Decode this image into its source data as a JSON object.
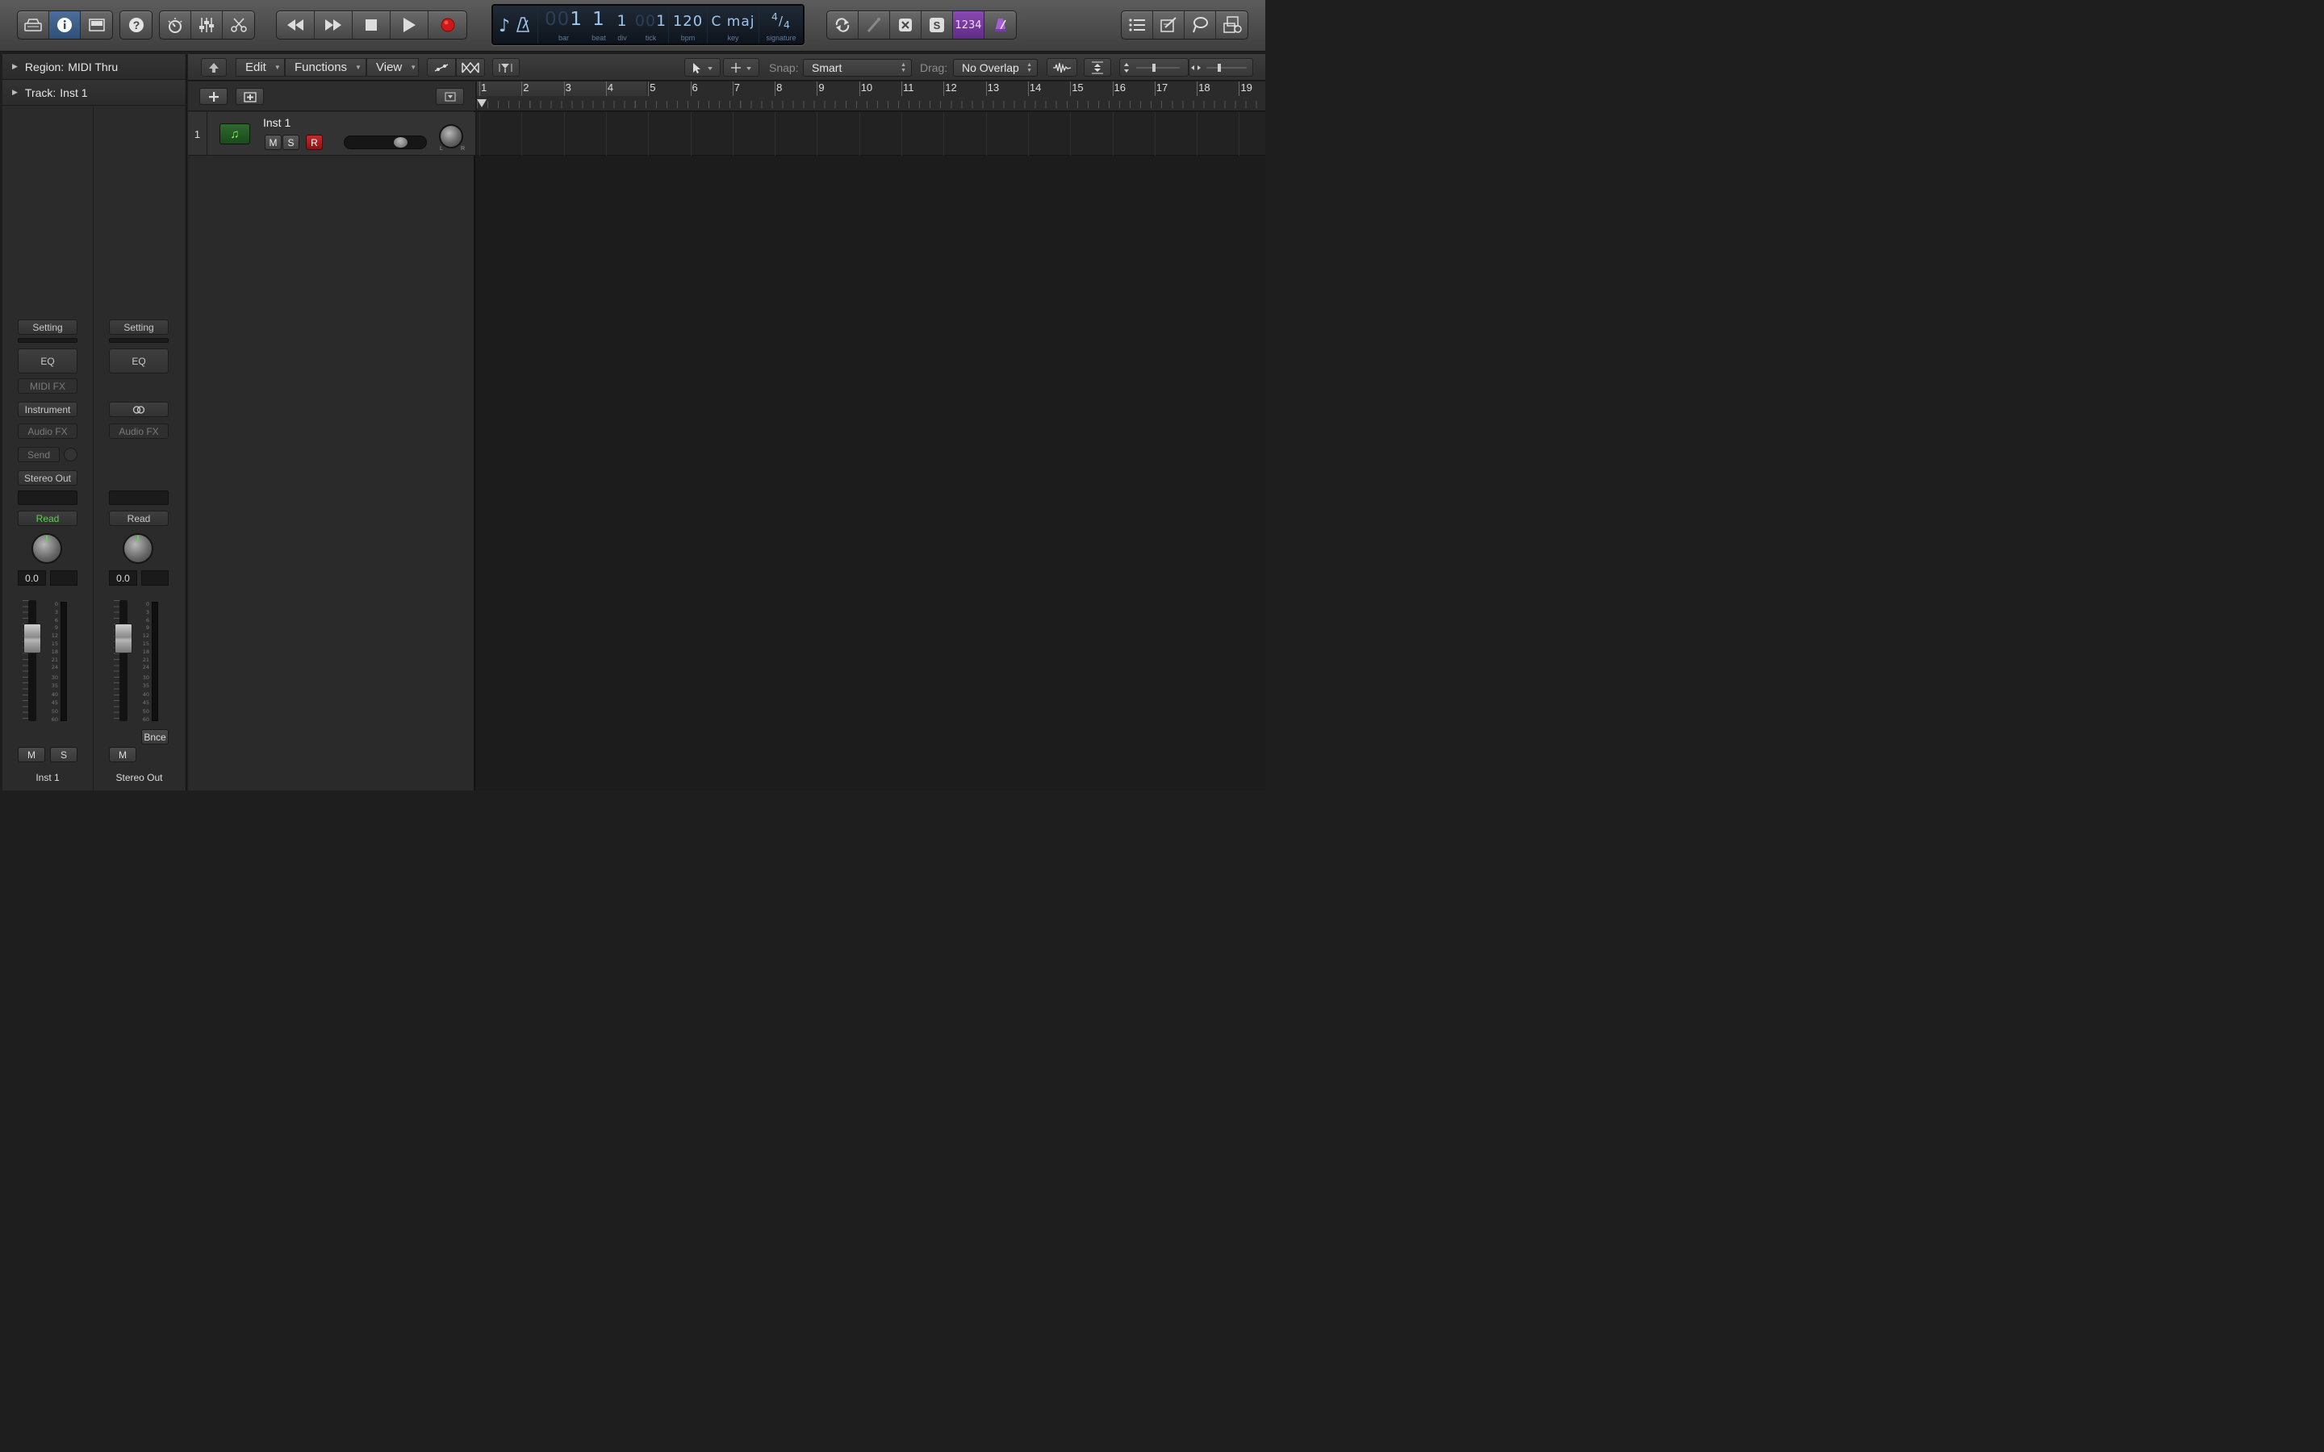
{
  "controlbar": {
    "left_icons": [
      "library-icon",
      "inspector-icon",
      "mail-icon"
    ],
    "help_icon": "help-icon",
    "mix_icons": [
      "smart-controls-icon",
      "mixer-icon",
      "editors-icon"
    ],
    "transport_icons": [
      "rewind-icon",
      "forward-icon",
      "stop-icon",
      "play-icon",
      "record-icon"
    ],
    "right_icons": [
      "cycle-icon",
      "tuner-icon",
      "replace-icon",
      "solo-icon",
      "count-in-icon",
      "metronome-icon"
    ],
    "count_in_label": "1234",
    "solo_label": "S",
    "far_right_icons": [
      "list-editors-icon",
      "note-pad-icon",
      "loop-browser-icon",
      "browsers-icon"
    ],
    "colors": {
      "accent_blue": "#3b6290",
      "metronome_purple": "#7a3aa6",
      "record_red": "#d01818",
      "read_green": "#58d048",
      "midi_region_green": "#2d6a2d"
    }
  },
  "lcd": {
    "bar": "1",
    "bar_prefix": "00",
    "beat": "1",
    "div": "1",
    "tick": "1",
    "tick_prefix": "00",
    "bpm": "120",
    "key": "C maj",
    "sig_top": "4",
    "sig_bottom": "4",
    "labels": {
      "bar": "bar",
      "beat": "beat",
      "div": "div",
      "tick": "tick",
      "bpm": "bpm",
      "key": "key",
      "signature": "signature"
    }
  },
  "inspector": {
    "region_label": "Region:",
    "region_value": "MIDI Thru",
    "track_label": "Track:",
    "track_value": "Inst 1",
    "strip1": {
      "setting": "Setting",
      "eq": "EQ",
      "midi_fx": "MIDI FX",
      "instrument": "Instrument",
      "audio_fx": "Audio FX",
      "send": "Send",
      "output": "Stereo Out",
      "automation": "Read",
      "volume": "0.0",
      "mute": "M",
      "solo": "S",
      "name": "Inst 1"
    },
    "strip2": {
      "setting": "Setting",
      "eq": "EQ",
      "audio_fx": "Audio FX",
      "automation": "Read",
      "volume": "0.0",
      "bounce": "Bnce",
      "mute": "M",
      "name": "Stereo Out"
    },
    "meter_scale": [
      "0",
      "3",
      "6",
      "9",
      "12",
      "15",
      "18",
      "21",
      "24",
      "30",
      "35",
      "40",
      "45",
      "50",
      "60"
    ]
  },
  "toolbar": {
    "edit": "Edit",
    "functions": "Functions",
    "view": "View",
    "snap_label": "Snap:",
    "snap_value": "Smart",
    "drag_label": "Drag:",
    "drag_value": "No Overlap"
  },
  "track": {
    "number": "1",
    "name": "Inst 1",
    "mute": "M",
    "solo": "S",
    "record": "R",
    "pan_l": "L",
    "pan_r": "R"
  },
  "ruler": {
    "bars": [
      "1",
      "2",
      "3",
      "4",
      "5",
      "6",
      "7",
      "8",
      "9",
      "10",
      "11",
      "12",
      "13",
      "14",
      "15",
      "16",
      "17",
      "18",
      "19"
    ]
  }
}
